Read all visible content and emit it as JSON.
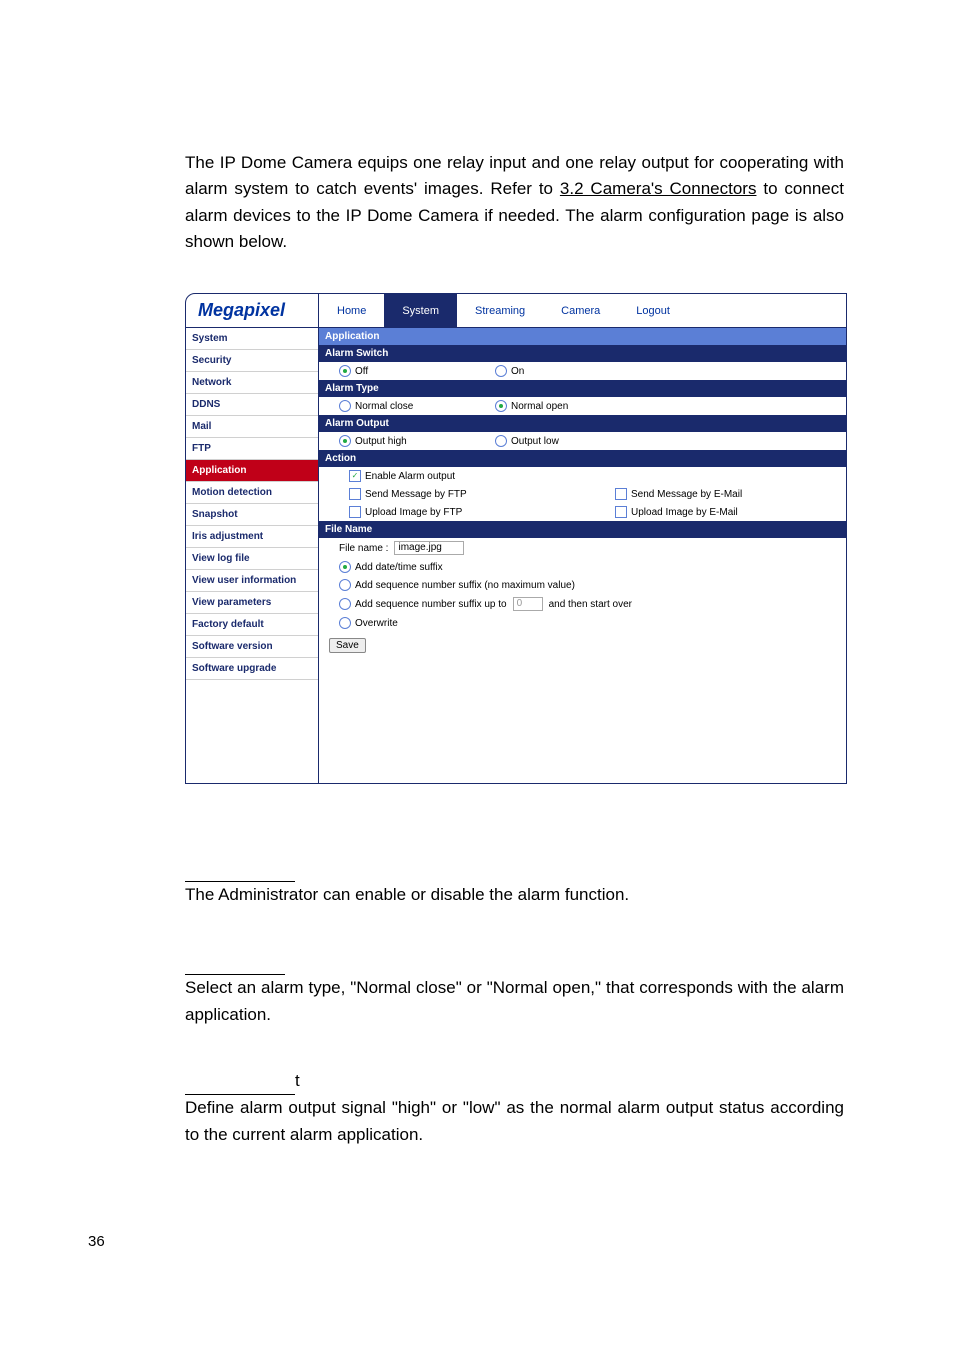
{
  "intro": {
    "p1a": "The IP Dome Camera equips one relay input and one relay output for cooperating with alarm system to catch events' images. Refer to ",
    "link": "3.2 Camera's Connectors",
    "p1b": " to connect alarm devices to the IP Dome Camera if needed. The alarm configuration page is also shown below."
  },
  "screenshot": {
    "logo": "Megapixel",
    "tabs": [
      "Home",
      "System",
      "Streaming",
      "Camera",
      "Logout"
    ],
    "active_tab_index": 1,
    "sidebar": [
      "System",
      "Security",
      "Network",
      "DDNS",
      "Mail",
      "FTP",
      "Application",
      "Motion detection",
      "Snapshot",
      "Iris adjustment",
      "View log file",
      "View user information",
      "View parameters",
      "Factory default",
      "Software version",
      "Software upgrade"
    ],
    "active_sidebar_index": 6,
    "content": {
      "app_title": "Application",
      "alarm_switch": {
        "title": "Alarm Switch",
        "off": "Off",
        "on": "On"
      },
      "alarm_type": {
        "title": "Alarm Type",
        "close": "Normal close",
        "open": "Normal open"
      },
      "alarm_output": {
        "title": "Alarm Output",
        "high": "Output high",
        "low": "Output low"
      },
      "action": {
        "title": "Action",
        "enable": "Enable Alarm output",
        "ftp_msg": "Send Message by FTP",
        "email_msg": "Send Message by E-Mail",
        "ftp_img": "Upload Image by FTP",
        "email_img": "Upload Image by E-Mail"
      },
      "file": {
        "title": "File Name",
        "label": "File name :",
        "value": "image.jpg",
        "opt1": "Add date/time suffix",
        "opt2": "Add sequence number suffix (no maximum value)",
        "opt3a": "Add sequence number suffix up to",
        "opt3_val": "0",
        "opt3b": "and then start over",
        "opt4": "Overwrite"
      },
      "save": "Save"
    }
  },
  "sections": {
    "s1_tail": "",
    "s1_body": "The Administrator can enable or disable the alarm function.",
    "s2_tail": "",
    "s2_body": "Select an alarm type, \"Normal close\" or \"Normal open,\" that corresponds with the alarm application.",
    "s3_tail": "t",
    "s3_body": "Define alarm output signal \"high\" or \"low\" as the normal alarm output status according to the current alarm application."
  },
  "page_number": "36"
}
